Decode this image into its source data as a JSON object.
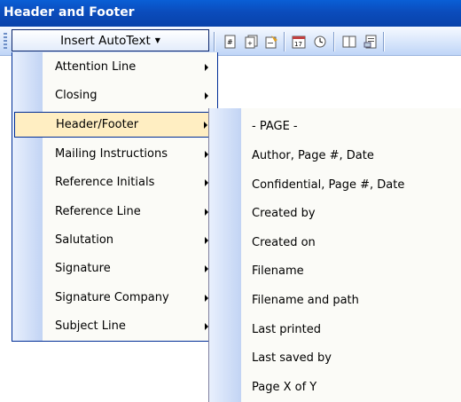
{
  "window": {
    "title": "Header and Footer"
  },
  "toolbar": {
    "autotext_label": "Insert AutoText",
    "icons": [
      "insert-page-number-icon",
      "insert-number-of-pages-icon",
      "format-page-number-icon",
      "insert-date-icon",
      "insert-time-icon",
      "page-setup-icon",
      "show-hide-document-text-icon"
    ]
  },
  "autotext_menu": {
    "items": [
      {
        "label": "Attention Line"
      },
      {
        "label": "Closing"
      },
      {
        "label": "Header/Footer"
      },
      {
        "label": "Mailing Instructions"
      },
      {
        "label": "Reference Initials"
      },
      {
        "label": "Reference Line"
      },
      {
        "label": "Salutation"
      },
      {
        "label": "Signature"
      },
      {
        "label": "Signature Company"
      },
      {
        "label": "Subject Line"
      }
    ],
    "active_item": "Header/Footer"
  },
  "header_footer_submenu": {
    "items": [
      {
        "label": "- PAGE -"
      },
      {
        "label": "Author, Page #, Date"
      },
      {
        "label": "Confidential, Page #, Date"
      },
      {
        "label": "Created by"
      },
      {
        "label": "Created on"
      },
      {
        "label": "Filename"
      },
      {
        "label": "Filename and path"
      },
      {
        "label": "Last printed"
      },
      {
        "label": "Last saved by"
      },
      {
        "label": "Page X of Y"
      }
    ]
  },
  "colors": {
    "titlebar": "#0b4cbc",
    "menu_highlight": "#ffeec2",
    "menu_border": "#002d96"
  }
}
